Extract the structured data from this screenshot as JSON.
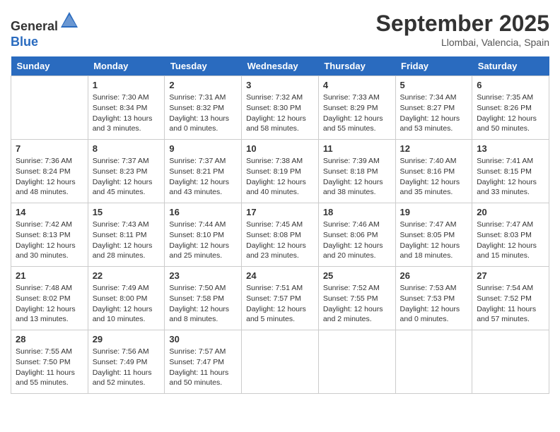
{
  "header": {
    "logo_general": "General",
    "logo_blue": "Blue",
    "month_title": "September 2025",
    "location": "Llombai, Valencia, Spain"
  },
  "days_of_week": [
    "Sunday",
    "Monday",
    "Tuesday",
    "Wednesday",
    "Thursday",
    "Friday",
    "Saturday"
  ],
  "weeks": [
    [
      {
        "num": "",
        "info": ""
      },
      {
        "num": "1",
        "info": "Sunrise: 7:30 AM\nSunset: 8:34 PM\nDaylight: 13 hours\nand 3 minutes."
      },
      {
        "num": "2",
        "info": "Sunrise: 7:31 AM\nSunset: 8:32 PM\nDaylight: 13 hours\nand 0 minutes."
      },
      {
        "num": "3",
        "info": "Sunrise: 7:32 AM\nSunset: 8:30 PM\nDaylight: 12 hours\nand 58 minutes."
      },
      {
        "num": "4",
        "info": "Sunrise: 7:33 AM\nSunset: 8:29 PM\nDaylight: 12 hours\nand 55 minutes."
      },
      {
        "num": "5",
        "info": "Sunrise: 7:34 AM\nSunset: 8:27 PM\nDaylight: 12 hours\nand 53 minutes."
      },
      {
        "num": "6",
        "info": "Sunrise: 7:35 AM\nSunset: 8:26 PM\nDaylight: 12 hours\nand 50 minutes."
      }
    ],
    [
      {
        "num": "7",
        "info": "Sunrise: 7:36 AM\nSunset: 8:24 PM\nDaylight: 12 hours\nand 48 minutes."
      },
      {
        "num": "8",
        "info": "Sunrise: 7:37 AM\nSunset: 8:23 PM\nDaylight: 12 hours\nand 45 minutes."
      },
      {
        "num": "9",
        "info": "Sunrise: 7:37 AM\nSunset: 8:21 PM\nDaylight: 12 hours\nand 43 minutes."
      },
      {
        "num": "10",
        "info": "Sunrise: 7:38 AM\nSunset: 8:19 PM\nDaylight: 12 hours\nand 40 minutes."
      },
      {
        "num": "11",
        "info": "Sunrise: 7:39 AM\nSunset: 8:18 PM\nDaylight: 12 hours\nand 38 minutes."
      },
      {
        "num": "12",
        "info": "Sunrise: 7:40 AM\nSunset: 8:16 PM\nDaylight: 12 hours\nand 35 minutes."
      },
      {
        "num": "13",
        "info": "Sunrise: 7:41 AM\nSunset: 8:15 PM\nDaylight: 12 hours\nand 33 minutes."
      }
    ],
    [
      {
        "num": "14",
        "info": "Sunrise: 7:42 AM\nSunset: 8:13 PM\nDaylight: 12 hours\nand 30 minutes."
      },
      {
        "num": "15",
        "info": "Sunrise: 7:43 AM\nSunset: 8:11 PM\nDaylight: 12 hours\nand 28 minutes."
      },
      {
        "num": "16",
        "info": "Sunrise: 7:44 AM\nSunset: 8:10 PM\nDaylight: 12 hours\nand 25 minutes."
      },
      {
        "num": "17",
        "info": "Sunrise: 7:45 AM\nSunset: 8:08 PM\nDaylight: 12 hours\nand 23 minutes."
      },
      {
        "num": "18",
        "info": "Sunrise: 7:46 AM\nSunset: 8:06 PM\nDaylight: 12 hours\nand 20 minutes."
      },
      {
        "num": "19",
        "info": "Sunrise: 7:47 AM\nSunset: 8:05 PM\nDaylight: 12 hours\nand 18 minutes."
      },
      {
        "num": "20",
        "info": "Sunrise: 7:47 AM\nSunset: 8:03 PM\nDaylight: 12 hours\nand 15 minutes."
      }
    ],
    [
      {
        "num": "21",
        "info": "Sunrise: 7:48 AM\nSunset: 8:02 PM\nDaylight: 12 hours\nand 13 minutes."
      },
      {
        "num": "22",
        "info": "Sunrise: 7:49 AM\nSunset: 8:00 PM\nDaylight: 12 hours\nand 10 minutes."
      },
      {
        "num": "23",
        "info": "Sunrise: 7:50 AM\nSunset: 7:58 PM\nDaylight: 12 hours\nand 8 minutes."
      },
      {
        "num": "24",
        "info": "Sunrise: 7:51 AM\nSunset: 7:57 PM\nDaylight: 12 hours\nand 5 minutes."
      },
      {
        "num": "25",
        "info": "Sunrise: 7:52 AM\nSunset: 7:55 PM\nDaylight: 12 hours\nand 2 minutes."
      },
      {
        "num": "26",
        "info": "Sunrise: 7:53 AM\nSunset: 7:53 PM\nDaylight: 12 hours\nand 0 minutes."
      },
      {
        "num": "27",
        "info": "Sunrise: 7:54 AM\nSunset: 7:52 PM\nDaylight: 11 hours\nand 57 minutes."
      }
    ],
    [
      {
        "num": "28",
        "info": "Sunrise: 7:55 AM\nSunset: 7:50 PM\nDaylight: 11 hours\nand 55 minutes."
      },
      {
        "num": "29",
        "info": "Sunrise: 7:56 AM\nSunset: 7:49 PM\nDaylight: 11 hours\nand 52 minutes."
      },
      {
        "num": "30",
        "info": "Sunrise: 7:57 AM\nSunset: 7:47 PM\nDaylight: 11 hours\nand 50 minutes."
      },
      {
        "num": "",
        "info": ""
      },
      {
        "num": "",
        "info": ""
      },
      {
        "num": "",
        "info": ""
      },
      {
        "num": "",
        "info": ""
      }
    ]
  ]
}
